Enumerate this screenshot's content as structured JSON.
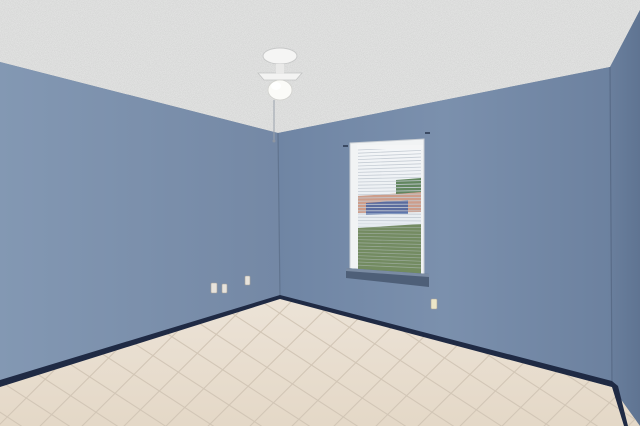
{
  "scene": {
    "kind": "empty room photograph",
    "objects": [
      "textured-ceiling",
      "ceiling-fan",
      "left-wall",
      "back-wall",
      "right-wall",
      "window-with-blinds",
      "electrical-outlets",
      "baseboards",
      "tile-floor"
    ],
    "colors": {
      "ceiling": "#e4e5e4",
      "wall_left": "#7d92ae",
      "wall_back": "#7389a8",
      "wall_right": "#6a7f9d",
      "baseboard": "#1f2a44",
      "floor_tile": "#e9dfd2",
      "grout": "#d2c6b6",
      "window_frame": "#f1f3f4",
      "blinds": "#e8eaed"
    }
  }
}
